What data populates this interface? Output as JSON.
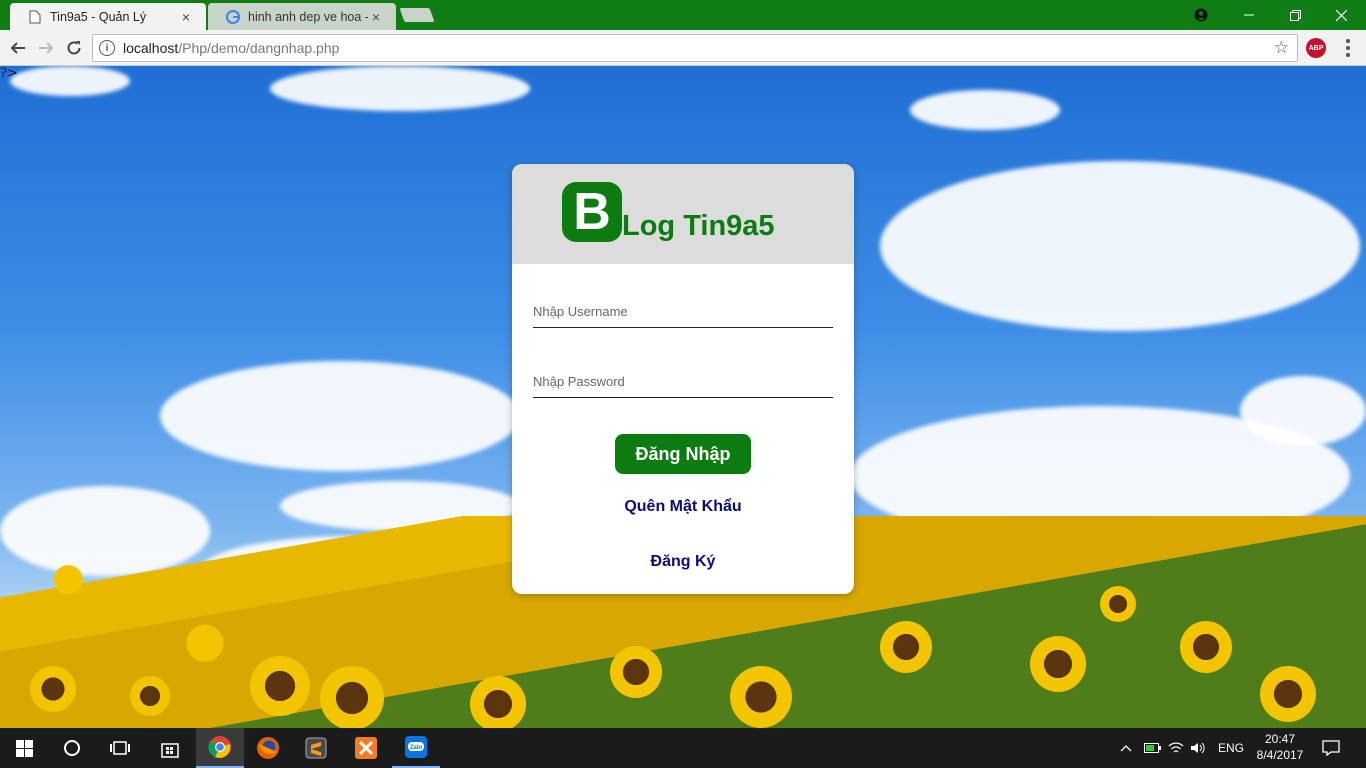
{
  "browser": {
    "tabs": [
      {
        "label": "Tin9a5 - Quản Lý",
        "close": "×"
      },
      {
        "label": "hinh anh dep ve hoa - Ti",
        "close": "×"
      }
    ],
    "url_host": "localhost",
    "url_path": "/Php/demo/dangnhap.php",
    "abp_label": "ABP"
  },
  "page": {
    "stray_text": "?>",
    "logo_letter": "B",
    "logo_text": "Log Tin9a5",
    "username_placeholder": "Nhập Username",
    "password_placeholder": "Nhập Password",
    "login_button": "Đăng Nhập",
    "forgot_link": "Quên Mật Khẩu",
    "register_link": "Đăng Ký"
  },
  "taskbar": {
    "language": "ENG",
    "time": "20:47",
    "date": "8/4/2017"
  },
  "colors": {
    "accent": "#0c7c10",
    "link": "#0b0b7a"
  }
}
